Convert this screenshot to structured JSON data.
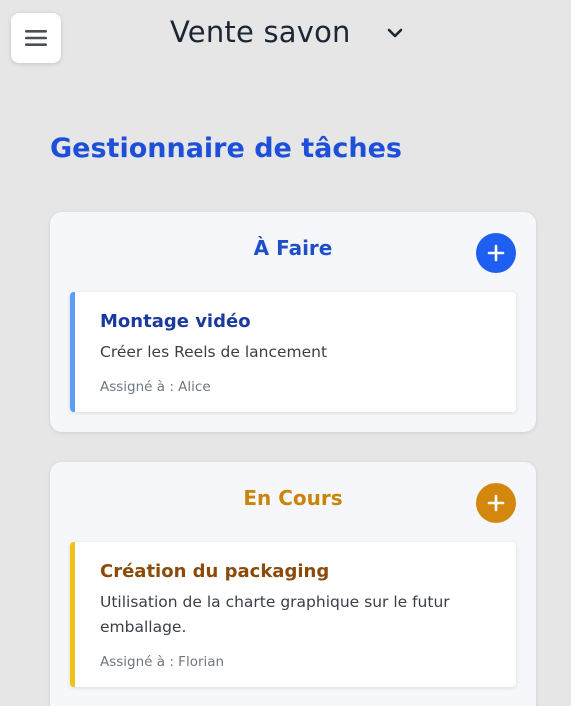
{
  "header": {
    "project_name": "Vente savon",
    "menu_icon": "hamburger-menu-icon",
    "dropdown_icon": "chevron-down-icon"
  },
  "page": {
    "title": "Gestionnaire de tâches"
  },
  "columns": [
    {
      "title": "À Faire",
      "accent": "#1e4fc9",
      "add_button_color": "#1e5ef0",
      "add_icon": "plus-icon",
      "tasks": [
        {
          "title": "Montage vidéo",
          "description": "Créer les Reels de lancement",
          "assignee": "Assigné à : Alice",
          "border_color": "#5b9cf5"
        }
      ]
    },
    {
      "title": "En Cours",
      "accent": "#c9850a",
      "add_button_color": "#d4870d",
      "add_icon": "plus-icon",
      "tasks": [
        {
          "title": "Création du packaging",
          "description": "Utilisation de la charte graphique sur le futur emballage.",
          "assignee": "Assigné à : Florian",
          "border_color": "#f2c118"
        }
      ]
    }
  ]
}
